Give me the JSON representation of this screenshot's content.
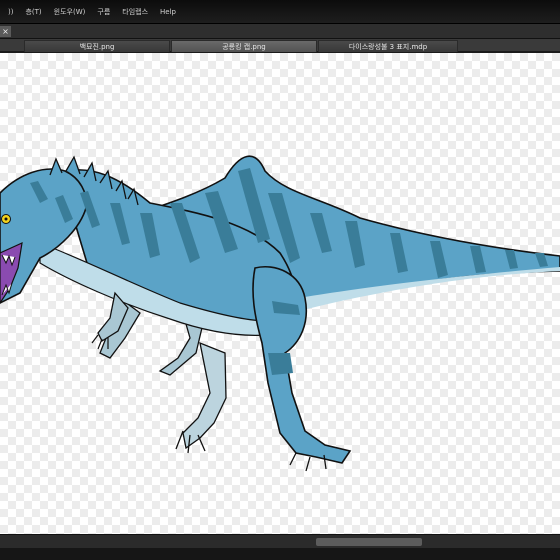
{
  "menu": {
    "items": [
      "))",
      "층(T)",
      "윈도우(W)",
      "구름",
      "타임랩스",
      "Help"
    ]
  },
  "tabs": {
    "close_glyph": "×",
    "documents": [
      {
        "label": "백묘진.png",
        "active": false
      },
      {
        "label": "공룡킹 캡.png",
        "active": true
      },
      {
        "label": "다이스랑성불 3 표지.mdp",
        "active": false
      }
    ]
  },
  "canvas": {
    "background": "transparency-checkerboard",
    "image": "blue-striped-dinosaur-drawing",
    "colors": {
      "body": "#5ba3c7",
      "belly": "#bfdde9",
      "stripes": "#3a7d99",
      "mouth": "#8a4bb0",
      "outline": "#111111",
      "eye": "#f2d21c"
    }
  },
  "scrollbar": {
    "orientation": "horizontal"
  }
}
